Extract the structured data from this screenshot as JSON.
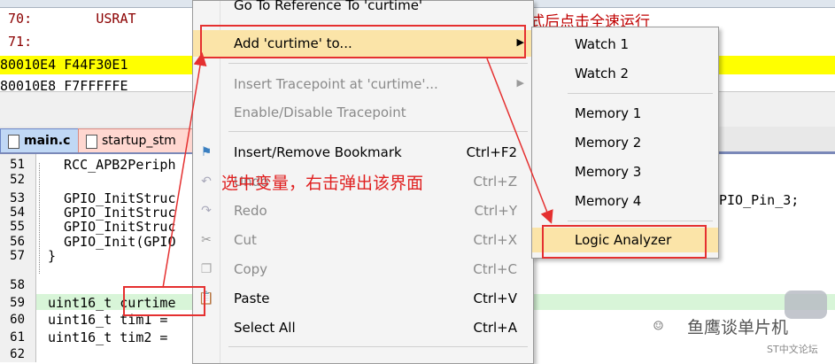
{
  "disassembly": {
    "lines": [
      {
        "text": " 70:        USRAT",
        "style": "red"
      },
      {
        "text": " 71:",
        "style": "red"
      },
      {
        "text": "80010E4 F44F30E1",
        "style": "yellow"
      },
      {
        "text": "80010E8 F7FFFFFE",
        "style": "plain"
      }
    ],
    "comment": "式后点击全速运行"
  },
  "tabs": [
    {
      "label": "main.c"
    },
    {
      "label": "startup_stm"
    }
  ],
  "editor": {
    "lines": [
      {
        "num": "51",
        "code": "  RCC_APB2Periph"
      },
      {
        "num": "52",
        "code": ""
      },
      {
        "num": "53",
        "code": "  GPIO_InitStruc"
      },
      {
        "num": "54",
        "code": "  GPIO_InitStruc"
      },
      {
        "num": "55",
        "code": "  GPIO_InitStruc"
      },
      {
        "num": "56",
        "code": "  GPIO_Init(GPIO"
      },
      {
        "num": "57",
        "code": "}"
      },
      {
        "num": "58",
        "code": ""
      },
      {
        "num": "59",
        "code": "uint16_t curtime"
      },
      {
        "num": "60",
        "code": "uint16_t tim1 ="
      },
      {
        "num": "61",
        "code": "uint16_t tim2 ="
      },
      {
        "num": "62",
        "code": ""
      }
    ],
    "partial_right": "PIO_Pin_3;"
  },
  "context_menu": {
    "items": [
      {
        "label": "Go To Reference To 'curtime'",
        "shortcut": "",
        "disabled": false,
        "submenu": false,
        "icon": ""
      },
      {
        "label": "Add 'curtime' to...",
        "shortcut": "",
        "disabled": false,
        "submenu": true,
        "icon": ""
      },
      {
        "label": "Insert Tracepoint at 'curtime'...",
        "shortcut": "",
        "disabled": true,
        "submenu": true,
        "icon": ""
      },
      {
        "label": "Enable/Disable Tracepoint",
        "shortcut": "",
        "disabled": true,
        "submenu": false,
        "icon": ""
      },
      {
        "label": "Insert/Remove Bookmark",
        "shortcut": "Ctrl+F2",
        "disabled": false,
        "submenu": false,
        "icon": "bookmark-icon"
      },
      {
        "label": "Undo",
        "shortcut": "Ctrl+Z",
        "disabled": true,
        "submenu": false,
        "icon": "undo-icon"
      },
      {
        "label": "Redo",
        "shortcut": "Ctrl+Y",
        "disabled": true,
        "submenu": false,
        "icon": "redo-icon"
      },
      {
        "label": "Cut",
        "shortcut": "Ctrl+X",
        "disabled": true,
        "submenu": false,
        "icon": "cut-icon"
      },
      {
        "label": "Copy",
        "shortcut": "Ctrl+C",
        "disabled": true,
        "submenu": false,
        "icon": "copy-icon"
      },
      {
        "label": "Paste",
        "shortcut": "Ctrl+V",
        "disabled": false,
        "submenu": false,
        "icon": "paste-icon"
      },
      {
        "label": "Select All",
        "shortcut": "Ctrl+A",
        "disabled": false,
        "submenu": false,
        "icon": ""
      }
    ]
  },
  "submenu": {
    "items": [
      {
        "label": "Watch 1"
      },
      {
        "label": "Watch 2"
      },
      {
        "label": "Memory 1"
      },
      {
        "label": "Memory 2"
      },
      {
        "label": "Memory 3"
      },
      {
        "label": "Memory 4"
      },
      {
        "label": "Logic Analyzer"
      }
    ]
  },
  "annotation": {
    "text": "选中变量，右击弹出该界面"
  },
  "watermark": {
    "main": "鱼鹰谈单片机",
    "sub": "ST中文论坛"
  },
  "colors": {
    "annotation_red": "#e53030",
    "highlight_yellow": "#ffff00",
    "menu_selected": "#fbe4a8"
  }
}
